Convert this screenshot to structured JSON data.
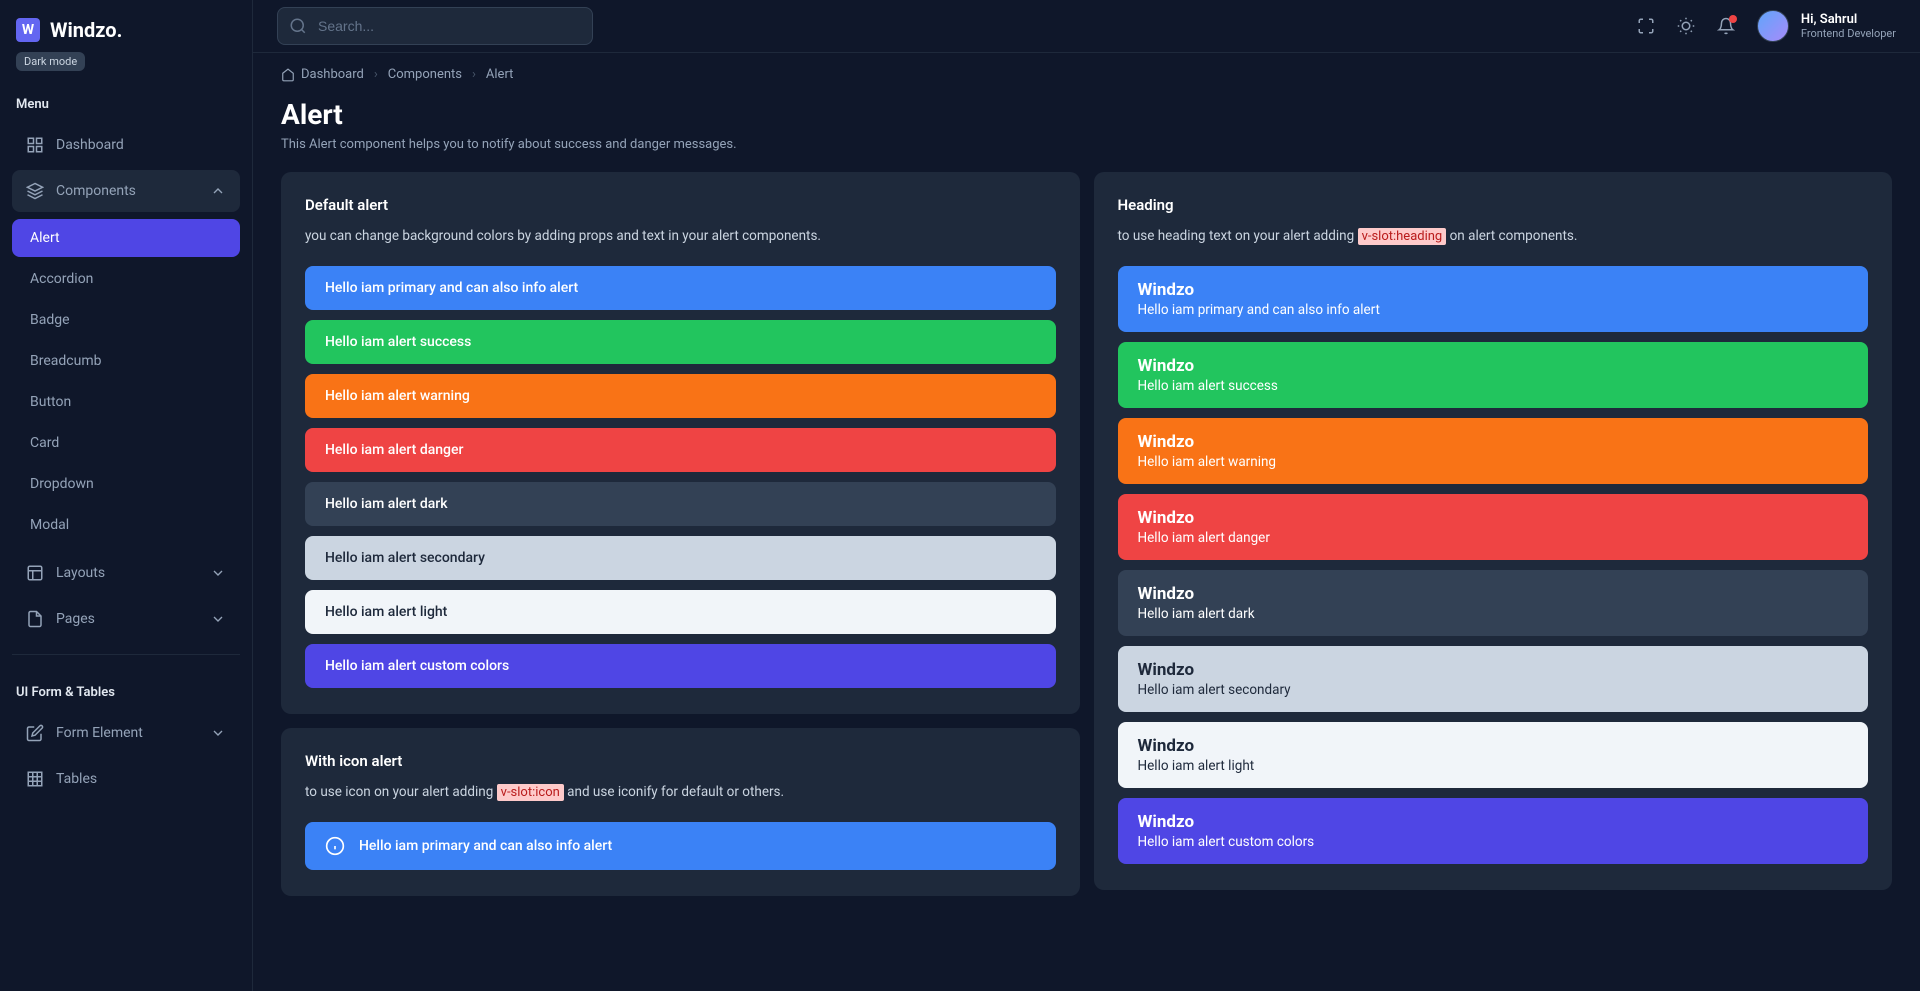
{
  "brand": {
    "name": "Windzo.",
    "logo_letter": "W",
    "mode_badge": "Dark mode"
  },
  "sidebar": {
    "menu_label": "Menu",
    "items": [
      {
        "icon": "dashboard-icon",
        "label": "Dashboard",
        "type": "link"
      },
      {
        "icon": "components-icon",
        "label": "Components",
        "type": "group",
        "expanded": true,
        "children": [
          "Alert",
          "Accordion",
          "Badge",
          "Breadcumb",
          "Button",
          "Card",
          "Dropdown",
          "Modal"
        ],
        "active_child": 0
      },
      {
        "icon": "layouts-icon",
        "label": "Layouts",
        "type": "group",
        "expanded": false
      },
      {
        "icon": "pages-icon",
        "label": "Pages",
        "type": "group",
        "expanded": false
      }
    ],
    "section2_label": "UI Form & Tables",
    "items2": [
      {
        "icon": "form-icon",
        "label": "Form Element",
        "type": "group",
        "expanded": false
      },
      {
        "icon": "tables-icon",
        "label": "Tables",
        "type": "link"
      }
    ]
  },
  "topbar": {
    "search_placeholder": "Search...",
    "user_greeting": "Hi, Sahrul",
    "user_role": "Frontend Developer"
  },
  "breadcrumb": [
    "Dashboard",
    "Components",
    "Alert"
  ],
  "page": {
    "title": "Alert",
    "subtitle": "This Alert component helps you to notify about success and danger messages."
  },
  "cards": {
    "default": {
      "title": "Default alert",
      "desc": "you can change background colors by adding props and text in your alert components.",
      "alerts": [
        {
          "variant": "primary",
          "text": "Hello iam primary and can also info alert"
        },
        {
          "variant": "success",
          "text": "Hello iam alert success"
        },
        {
          "variant": "warning",
          "text": "Hello iam alert warning"
        },
        {
          "variant": "danger",
          "text": "Hello iam alert danger"
        },
        {
          "variant": "dark",
          "text": "Hello iam alert dark"
        },
        {
          "variant": "secondary",
          "text": "Hello iam alert secondary"
        },
        {
          "variant": "light",
          "text": "Hello iam alert light"
        },
        {
          "variant": "custom",
          "text": "Hello iam alert custom colors"
        }
      ]
    },
    "heading": {
      "title": "Heading",
      "desc_pre": "to use heading text on your alert adding ",
      "desc_code": "v-slot:heading",
      "desc_post": " on alert components.",
      "heading_text": "Windzo",
      "alerts": [
        {
          "variant": "primary",
          "text": "Hello iam primary and can also info alert"
        },
        {
          "variant": "success",
          "text": "Hello iam alert success"
        },
        {
          "variant": "warning",
          "text": "Hello iam alert warning"
        },
        {
          "variant": "danger",
          "text": "Hello iam alert danger"
        },
        {
          "variant": "dark",
          "text": "Hello iam alert dark"
        },
        {
          "variant": "secondary",
          "text": "Hello iam alert secondary"
        },
        {
          "variant": "light",
          "text": "Hello iam alert light"
        },
        {
          "variant": "custom",
          "text": "Hello iam alert custom colors"
        }
      ]
    },
    "icon": {
      "title": "With icon alert",
      "desc_pre": "to use icon on your alert adding ",
      "desc_code": "v-slot:icon",
      "desc_post": " and use iconify for default or others.",
      "alerts": [
        {
          "variant": "primary",
          "text": "Hello iam primary and can also info alert"
        }
      ]
    }
  }
}
